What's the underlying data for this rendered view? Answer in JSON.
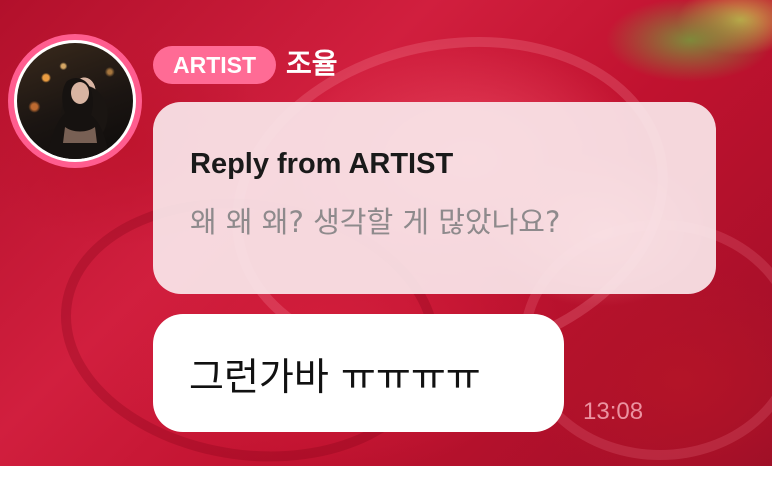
{
  "colors": {
    "badge_bg": "#ff6b95",
    "avatar_ring": "#ff5d8f",
    "reply_bubble_bg": "#fae8ec",
    "message_bubble_bg": "#ffffff",
    "name_color": "#ffffff"
  },
  "sender": {
    "badge_label": "ARTIST",
    "name": "조율",
    "avatar_icon": "profile-photo"
  },
  "reply": {
    "title": "Reply from ARTIST",
    "quoted_text": "왜 왜 왜? 생각할 게 많았나요?"
  },
  "message": {
    "text": "그런가바 ㅠㅠㅠㅠ",
    "time": "13:08"
  }
}
